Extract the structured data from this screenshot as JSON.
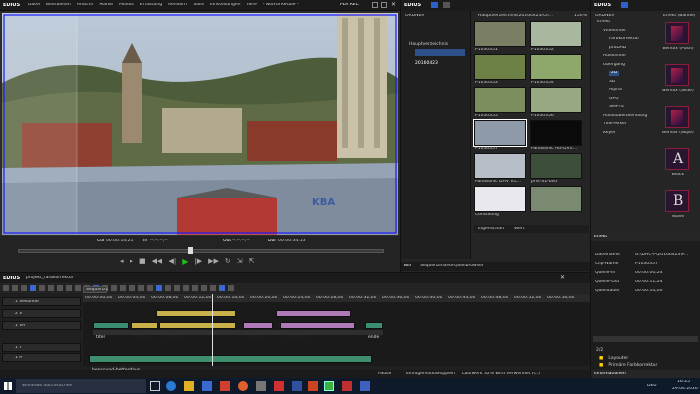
{
  "menu": {
    "app": "EDIUS",
    "items": [
      "Datei",
      "Bearbeiten",
      "Ansicht",
      "Marke",
      "Modus",
      "Erfassung",
      "Rendern",
      "Tools",
      "Einstellungen",
      "Hilfe",
      "- NotForResale -"
    ],
    "mode_badge": "PLR REC"
  },
  "preview": {
    "cur_label": "Cur",
    "cur_time": "00:00:14;21",
    "in_label": "In",
    "in_time": "--:--:--;--",
    "out_label": "Out",
    "out_time": "--:--:--;--",
    "dur_label": "Dur",
    "dur_time": "00:00:34;13"
  },
  "bin": {
    "app": "EDIUS",
    "folder_header": "ORDNER",
    "folders": [
      "Hauptverzeichnis",
      "20160422",
      "20160423"
    ],
    "path": "Hauptverzeichnis/20160423/Cli...",
    "zoom": "150%",
    "clips": [
      {
        "name": "P1030351",
        "color": "#7a7e62"
      },
      {
        "name": "P1030352",
        "color": "#a8b7a0"
      },
      {
        "name": "P1030353",
        "color": "#6d8045"
      },
      {
        "name": "P1030354",
        "color": "#8ea86c"
      },
      {
        "name": "P1030355",
        "color": "#7b8d5e"
      },
      {
        "name": "P1030356",
        "color": "#98a882"
      },
      {
        "name": "P1030357",
        "color": "#8e9aa8"
      },
      {
        "name": "Panasonic AG-DVX...",
        "color": "#0a0a0a"
      },
      {
        "name": "Panasonic DHV V.L...",
        "color": "#b7bec7"
      },
      {
        "name": "prfk-02-bild",
        "color": "#3d4f3a"
      },
      {
        "name": "Consulting",
        "color": "#e8e8ee"
      },
      {
        "name": "",
        "color": "#7a8a70"
      }
    ],
    "prop_tabs": [
      "Eigenschaft",
      "Wert"
    ],
    "bottom_tabs": [
      "Bin",
      "Sequenzmarke",
      "Quellbrowser"
    ]
  },
  "fx": {
    "app": "EDIUS",
    "folder_header": "ORDNER",
    "tree": [
      "Effekt",
      "Videofilter",
      "Farbkorrektur",
      "proDAD",
      "Audiofilter",
      "Übergang",
      "2D",
      "3D",
      "Alpha",
      "GPU",
      "SMPTE",
      "Audioüberblendung",
      "Titel-Mixer",
      "Keyer"
    ],
    "list_header": "Effekt (Bande)",
    "items": [
      "Bendix (Push)",
      "Bendix (Slide)",
      "Bendix (Wipe)",
      "Block",
      "Wave"
    ],
    "tab": "Effekt",
    "info_fields": [
      {
        "k": "Dateiname",
        "v": "G:\\DHC-P\\20160423\\P..."
      },
      {
        "k": "Clip-Name",
        "v": "P1030357"
      },
      {
        "k": "Quelle-In",
        "v": "00:00:00;24"
      },
      {
        "k": "Quelle-Out",
        "v": "00:00:11;24"
      },
      {
        "k": "Quelldauer",
        "v": "00:00:10;00"
      }
    ],
    "layers": [
      "Layouter",
      "Primäre Farbkorrektur"
    ],
    "info_tab": "Informationen"
  },
  "timeline": {
    "app": "EDIUS",
    "project": "projekt_farbkorrektur",
    "sequence": "Sequenz1",
    "ruler": [
      "00:00:00;00",
      "00:00:04;00",
      "00:00:08;00",
      "00:00:12;00",
      "00:00:16;00",
      "00:00:20;00",
      "00:00:24;00",
      "00:00:28;00",
      "00:00:32;00",
      "00:00:36;00",
      "00:00:40;00",
      "00:00:44;00",
      "00:00:48;00",
      "00:00:52;00",
      "00:00:56;00"
    ],
    "tracks": [
      "1 Sekunde",
      "2 V",
      "1 VA",
      "1 T",
      "1 A"
    ],
    "clips": {
      "v2a": "P1030357",
      "v2b": "prfk-02-bild",
      "va1": "titel",
      "va2": "P1030...",
      "va3": "P1030357",
      "va4": "prfk-02...",
      "va5": "prfk-02-bild",
      "va6": "ende",
      "audio": "bensound-betterdays"
    },
    "status": [
      "Pause",
      "Einfügemodus",
      "Rippeln",
      "Laufwerk 32% wird verwendet (C:)"
    ]
  },
  "taskbar": {
    "search": "Windows durchsuchen",
    "time": "16:25",
    "date": "29.04.2016",
    "lang": "DEU"
  }
}
